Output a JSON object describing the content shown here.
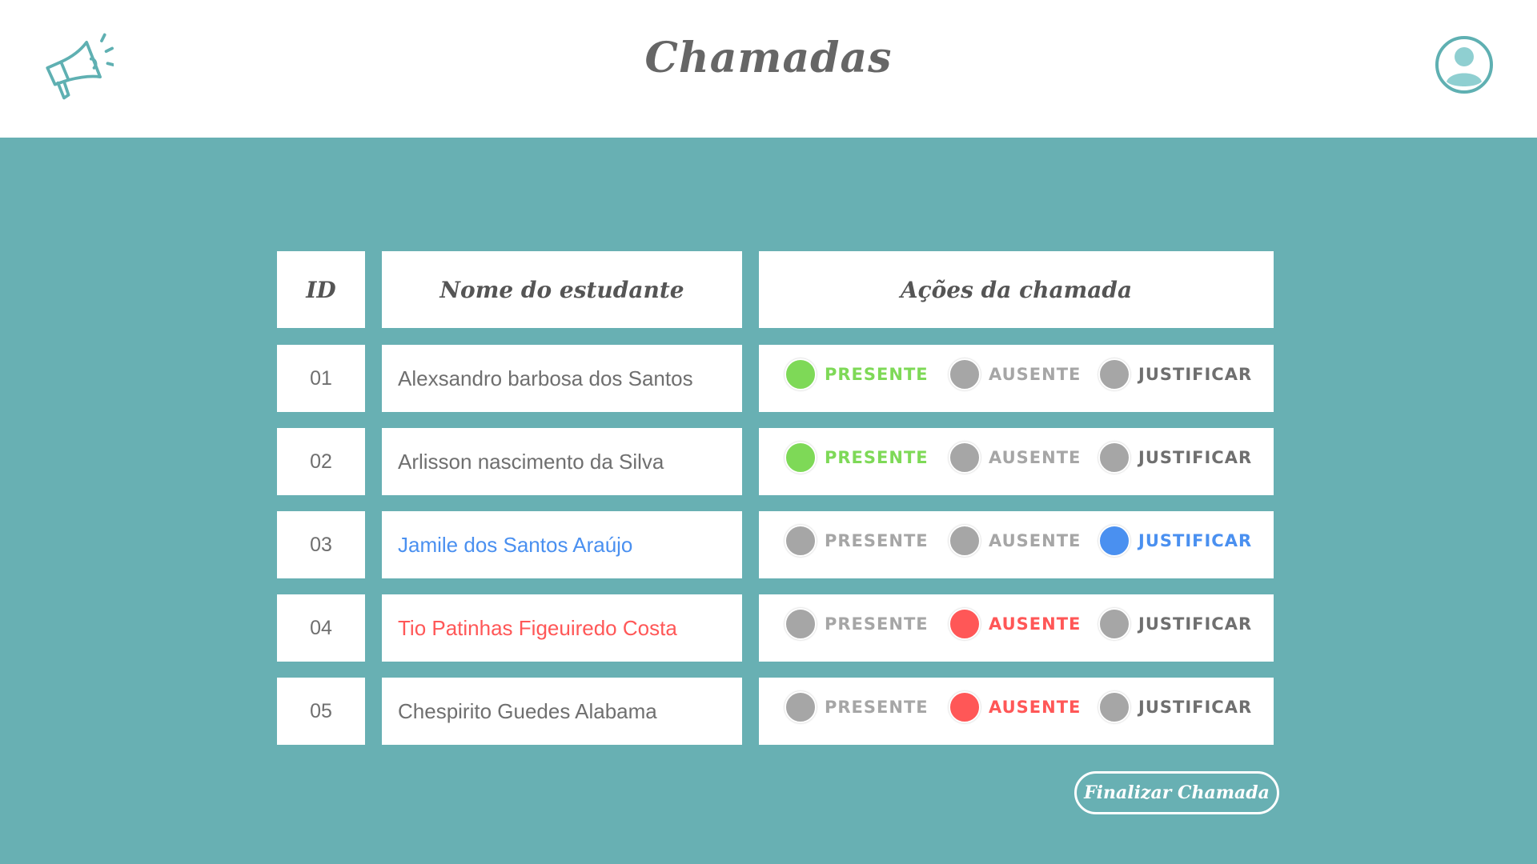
{
  "header": {
    "title": "Chamadas",
    "logo_icon": "megaphone-icon",
    "avatar_icon": "user-avatar-icon"
  },
  "table": {
    "columns": [
      "ID",
      "Nome do estudante",
      "Ações da chamada"
    ],
    "option_labels": [
      "PRESENTE",
      "AUSENTE",
      "JUSTIFICAR"
    ],
    "rows": [
      {
        "id": "01",
        "name": "Alexsandro barbosa dos Santos",
        "status": "PRESENTE"
      },
      {
        "id": "02",
        "name": "Arlisson nascimento da Silva",
        "status": "PRESENTE"
      },
      {
        "id": "03",
        "name": "Jamile dos Santos Araújo",
        "status": "JUSTIFICAR"
      },
      {
        "id": "04",
        "name": "Tio Patinhas Figeuiredo Costa",
        "status": "AUSENTE"
      },
      {
        "id": "05",
        "name": "Chespirito Guedes Alabama",
        "status": "AUSENTE"
      }
    ]
  },
  "colors": {
    "background": "#68b0b3",
    "presente": "#7ed957",
    "ausente": "#ff5757",
    "justificar": "#4a90f0",
    "inactive_dot": "#a6a6a6",
    "name_default": "#6f6f6f"
  },
  "finish_button": {
    "label": "Finalizar Chamada"
  }
}
